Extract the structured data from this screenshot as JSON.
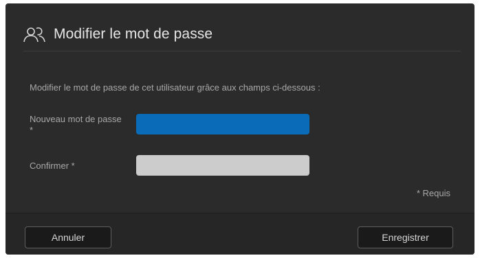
{
  "dialog": {
    "title": "Modifier le mot de passe",
    "title_icon": "users-icon",
    "instruction": "Modifier le mot de passe de cet utilisateur grâce aux champs ci-dessous :",
    "new_password": {
      "label": "Nouveau mot de passe *",
      "value": ""
    },
    "confirm_password": {
      "label": "Confirmer *",
      "value": ""
    },
    "required_note": "* Requis"
  },
  "footer": {
    "cancel_label": "Annuler",
    "save_label": "Enregistrer"
  },
  "colors": {
    "background": "#2b2b2b",
    "focused_input": "#0a6cb8",
    "input": "#cccccc"
  }
}
